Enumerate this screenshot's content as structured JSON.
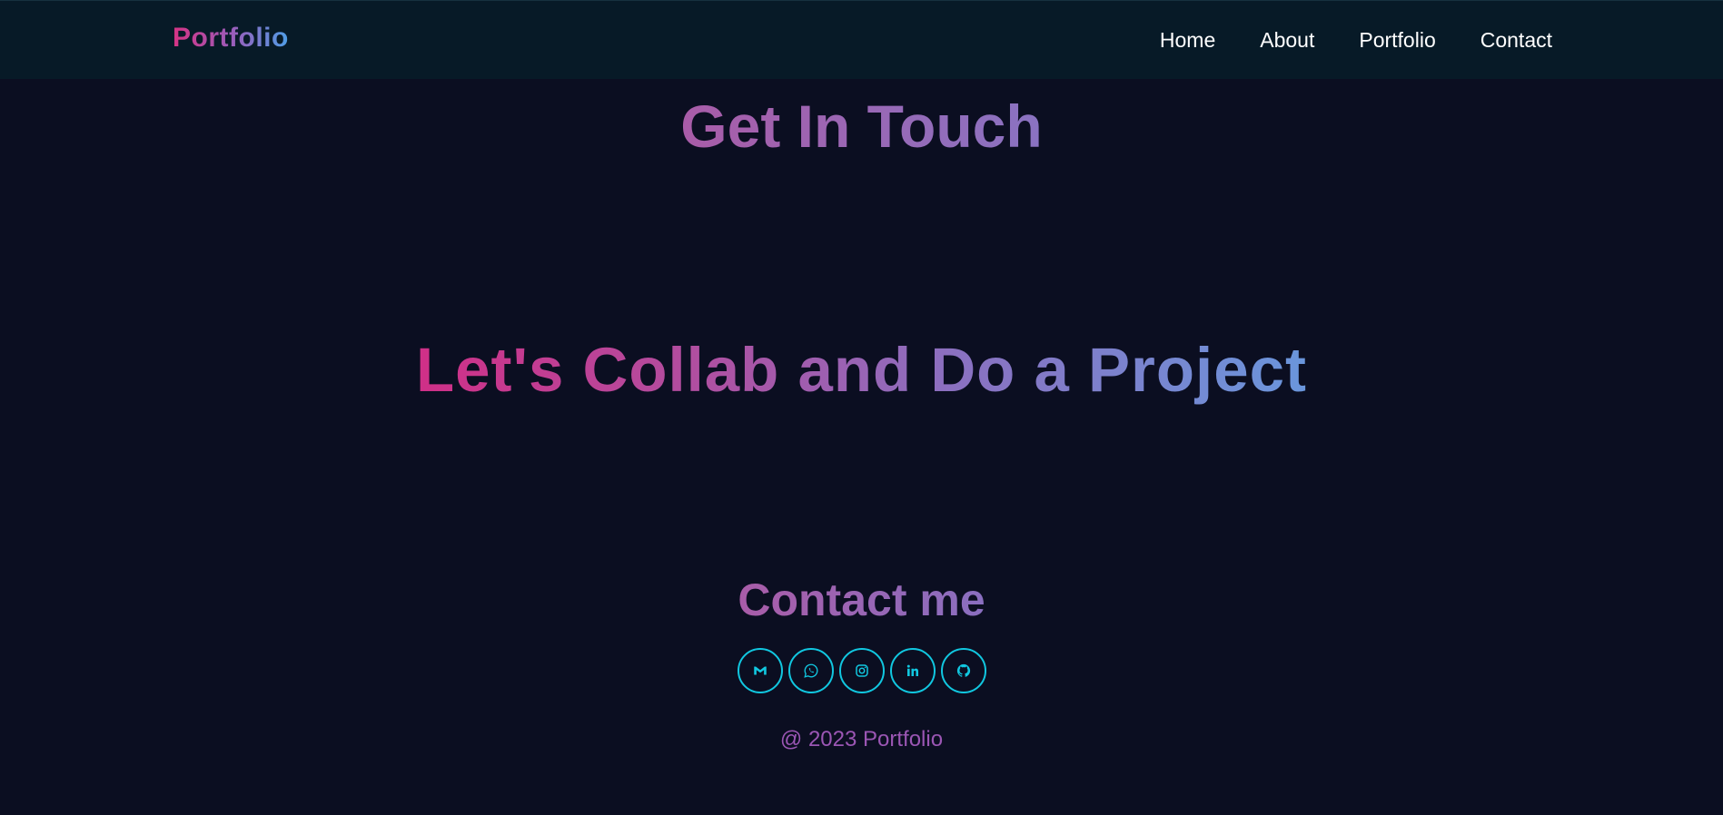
{
  "navbar": {
    "logo": "Portfolio",
    "links": [
      {
        "label": "Home"
      },
      {
        "label": "About"
      },
      {
        "label": "Portfolio"
      },
      {
        "label": "Contact"
      }
    ]
  },
  "contact": {
    "title": "Get In Touch",
    "tagline": "Let's Collab and Do a Project",
    "subtitle": "Contact me",
    "socials": [
      {
        "icon": "gmail-icon"
      },
      {
        "icon": "whatsapp-icon"
      },
      {
        "icon": "instagram-icon"
      },
      {
        "icon": "linkedin-icon"
      },
      {
        "icon": "github-icon"
      }
    ]
  },
  "footer": {
    "copyright": "@ 2023 Portfolio"
  },
  "colors": {
    "background": "#0b0e21",
    "navbar": "#071a27",
    "accent_cyan": "#11c7e0",
    "gradient_pink": "#d02f87",
    "gradient_blue": "#6a96dc"
  }
}
